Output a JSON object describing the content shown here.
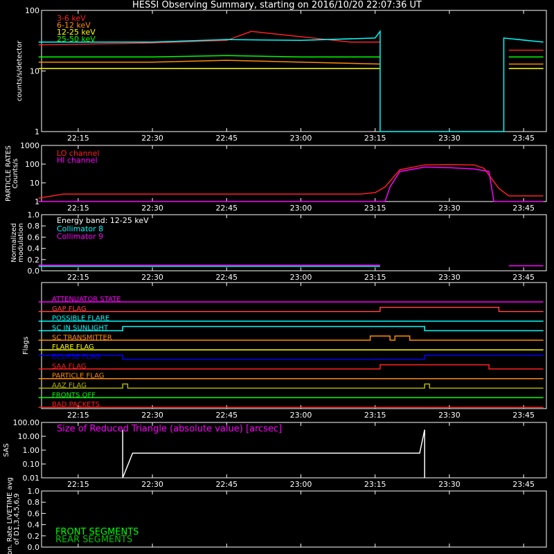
{
  "title": "HESSI Observing Summary, starting on 2016/10/20 22:07:36 UT",
  "time_axis": {
    "range": [
      "22:07:36",
      "23:49:36"
    ],
    "ticks": [
      "22:15",
      "22:30",
      "22:45",
      "23:00",
      "23:15",
      "23:30",
      "23:45"
    ]
  },
  "colors": {
    "background": "#000000",
    "axes": "#ffffff",
    "red": "#ff2020",
    "orange": "#ff8c00",
    "yellow": "#ffff00",
    "green": "#00ff00",
    "cyan": "#00ffff",
    "magenta": "#ff00ff",
    "blue": "#0000ff",
    "olive": "#b4b400",
    "darkgreen": "#00c000"
  },
  "chart_data": [
    {
      "id": "counts",
      "type": "line",
      "ylabel": "counts/s/detector",
      "yscale": "log",
      "ylim": [
        1,
        100
      ],
      "yticks": [
        "1",
        "10",
        "100"
      ],
      "series": [
        {
          "name": "3-6 keV",
          "color": "#ff2020",
          "x": [
            "22:07",
            "22:30",
            "22:45",
            "22:50",
            "23:10",
            "23:16",
            "23:17",
            "23:41",
            "23:42",
            "23:49"
          ],
          "y": [
            27,
            29,
            32,
            45,
            30,
            30,
            null,
            null,
            22,
            22
          ]
        },
        {
          "name": "6-12 keV",
          "color": "#ff8c00",
          "x": [
            "22:07",
            "22:30",
            "22:45",
            "23:00",
            "23:16",
            "23:17",
            "23:41",
            "23:42",
            "23:49"
          ],
          "y": [
            14,
            14,
            15,
            14,
            13,
            null,
            null,
            13,
            13
          ]
        },
        {
          "name": "12-25 keV",
          "color": "#ffff00",
          "x": [
            "22:07",
            "22:30",
            "22:45",
            "23:00",
            "23:16",
            "23:17",
            "23:41",
            "23:42",
            "23:49"
          ],
          "y": [
            11,
            11,
            11,
            11,
            11,
            null,
            null,
            11,
            11
          ]
        },
        {
          "name": "25-50 keV",
          "color": "#00ff00",
          "x": [
            "22:07",
            "22:30",
            "22:45",
            "23:00",
            "23:16",
            "23:17",
            "23:41",
            "23:42",
            "23:49"
          ],
          "y": [
            17,
            17,
            18,
            17,
            17,
            null,
            null,
            17,
            17
          ]
        },
        {
          "name": "",
          "color": "#00ffff",
          "x": [
            "22:07",
            "22:30",
            "22:45",
            "23:00",
            "23:15",
            "23:16",
            "23:16",
            "23:41",
            "23:41",
            "23:49"
          ],
          "y": [
            30,
            30,
            33,
            32,
            35,
            45,
            1,
            1,
            35,
            30
          ]
        }
      ]
    },
    {
      "id": "particle",
      "type": "line",
      "ylabel": "PARTICLE RATES Counts/s",
      "yscale": "log",
      "ylim": [
        1,
        1000
      ],
      "yticks": [
        "1",
        "10",
        "100",
        "1000"
      ],
      "series": [
        {
          "name": "LO channel",
          "color": "#ff2020",
          "x": [
            "22:07",
            "22:12",
            "23:12",
            "23:15",
            "23:17",
            "23:20",
            "23:25",
            "23:30",
            "23:35",
            "23:37",
            "23:40",
            "23:42",
            "23:49"
          ],
          "y": [
            1.5,
            2.5,
            2.5,
            3,
            6,
            50,
            90,
            95,
            90,
            60,
            5,
            2,
            2
          ]
        },
        {
          "name": "HI channel",
          "color": "#ff00ff",
          "x": [
            "22:07",
            "23:17",
            "23:18",
            "23:20",
            "23:25",
            "23:30",
            "23:35",
            "23:38",
            "23:39",
            "23:49"
          ],
          "y": [
            1,
            1,
            6,
            40,
            70,
            65,
            55,
            40,
            1,
            1
          ]
        }
      ]
    },
    {
      "id": "modulation",
      "type": "line",
      "ylabel": "Normalized modulation",
      "ylim": [
        0,
        1
      ],
      "yticks": [
        "0.0",
        "0.2",
        "0.4",
        "0.6",
        "0.8",
        "1.0"
      ],
      "annotation": "Energy band: 12-25 keV",
      "series": [
        {
          "name": "Collimator 8",
          "color": "#00ffff",
          "x": [
            "22:07",
            "23:16"
          ],
          "y": [
            0.08,
            0.08
          ]
        },
        {
          "name": "Collimator 9",
          "color": "#ff00ff",
          "x": [
            "22:07",
            "22:45",
            "23:16",
            "23:17",
            "23:41",
            "23:42",
            "23:49"
          ],
          "y": [
            0.1,
            0.1,
            0.1,
            null,
            null,
            0.09,
            0.09
          ]
        }
      ]
    },
    {
      "id": "flags",
      "type": "line",
      "ylabel": "Flags",
      "series": [
        {
          "name": "ATTENUATOR STATE",
          "color": "#ff00ff",
          "x": [
            "22:07",
            "23:49"
          ],
          "y": [
            0,
            0
          ]
        },
        {
          "name": "GAP FLAG",
          "color": "#ff4040",
          "x": [
            "22:07",
            "23:16",
            "23:16",
            "23:40",
            "23:40",
            "23:49"
          ],
          "y": [
            0,
            0,
            1,
            1,
            0,
            0
          ]
        },
        {
          "name": "POSSIBLE FLARE",
          "color": "#00ffff",
          "x": [
            "22:07",
            "23:49"
          ],
          "y": [
            0,
            0
          ]
        },
        {
          "name": "SC IN SUNLIGHT",
          "color": "#00ffff",
          "x": [
            "22:07",
            "22:24",
            "22:24",
            "23:25",
            "23:25",
            "23:49"
          ],
          "y": [
            0,
            0,
            1,
            1,
            0,
            0
          ]
        },
        {
          "name": "SC TRANSMITTER",
          "color": "#ff8c00",
          "x": [
            "22:07",
            "23:14",
            "23:14",
            "23:18",
            "23:18",
            "23:19",
            "23:19",
            "23:22",
            "23:22",
            "23:49"
          ],
          "y": [
            0,
            0,
            1,
            1,
            0,
            0,
            1,
            1,
            0,
            0
          ]
        },
        {
          "name": "FLARE FLAG",
          "color": "#ffff00",
          "x": [
            "22:07",
            "23:49"
          ],
          "y": [
            0,
            0
          ]
        },
        {
          "name": "ECLIPSE FLAG",
          "color": "#0000ff",
          "x": [
            "22:07",
            "22:24",
            "22:24",
            "23:25",
            "23:25",
            "23:49"
          ],
          "y": [
            1,
            1,
            0,
            0,
            1,
            1
          ]
        },
        {
          "name": "SAA FLAG",
          "color": "#ff2020",
          "x": [
            "22:07",
            "23:16",
            "23:16",
            "23:38",
            "23:38",
            "23:49"
          ],
          "y": [
            0,
            0,
            1,
            1,
            0,
            0
          ]
        },
        {
          "name": "PARTICLE FLAG",
          "color": "#ff8c00",
          "x": [
            "22:07",
            "23:49"
          ],
          "y": [
            0,
            0
          ]
        },
        {
          "name": "AAZ FLAG",
          "color": "#b4b400",
          "x": [
            "22:07",
            "22:24",
            "22:24",
            "22:25",
            "22:25",
            "23:25",
            "23:25",
            "23:26",
            "23:26",
            "23:49"
          ],
          "y": [
            0,
            0,
            1,
            1,
            0,
            0,
            1,
            1,
            0,
            0
          ]
        },
        {
          "name": "FRONTS OFF",
          "color": "#00ff00",
          "x": [
            "22:07",
            "23:49"
          ],
          "y": [
            0,
            0
          ]
        },
        {
          "name": "BAD PACKETS",
          "color": "#ff2020",
          "x": [
            "22:07",
            "23:49"
          ],
          "y": [
            0,
            0
          ]
        }
      ]
    },
    {
      "id": "sas",
      "type": "line",
      "ylabel": "SAS",
      "yscale": "log",
      "ylim": [
        0.01,
        100
      ],
      "yticks": [
        "0.01",
        "0.10",
        "1.00",
        "10.00",
        "100.00"
      ],
      "annotation": "Size of Reduced Triangle (absolute value) [arcsec]",
      "series": [
        {
          "name": "",
          "color": "#ffffff",
          "x": [
            "22:24",
            "22:24",
            "22:26",
            "22:45",
            "23:00",
            "23:15",
            "23:24",
            "23:25",
            "23:25"
          ],
          "y": [
            30,
            0.01,
            0.6,
            0.6,
            0.6,
            0.6,
            0.6,
            30,
            0.01
          ]
        }
      ]
    },
    {
      "id": "livetime",
      "type": "line",
      "ylabel": "Mon. Rate LIVETIME avg of D1,3,4,5,6,9",
      "ylim": [
        0,
        1
      ],
      "yticks": [
        "0.0",
        "0.2",
        "0.4",
        "0.6",
        "0.8",
        "1.0"
      ],
      "series": [
        {
          "name": "FRONT SEGMENTS",
          "color": "#00ff00",
          "x": [],
          "y": []
        },
        {
          "name": "REAR SEGMENTS",
          "color": "#00c000",
          "x": [],
          "y": []
        }
      ]
    }
  ]
}
